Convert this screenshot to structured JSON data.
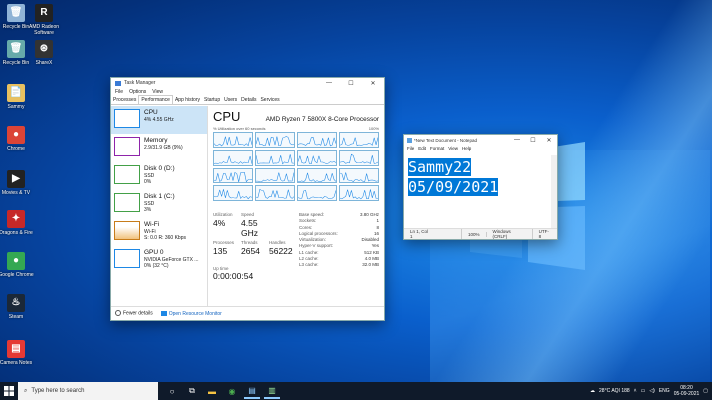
{
  "desktop": {
    "icons": [
      {
        "label": "Recycle Bin",
        "glyph": "🗑",
        "bg": "#8fb3d6"
      },
      {
        "label": "AMD Radeon Software",
        "glyph": "R",
        "bg": "#222"
      },
      {
        "label": "Recycle Bin",
        "glyph": "🗑",
        "bg": "#6aa"
      },
      {
        "label": "ShareX",
        "glyph": "⊛",
        "bg": "#333"
      },
      {
        "label": "Sammy",
        "glyph": "📄",
        "bg": "#e8c060"
      },
      {
        "label": "Chrome",
        "glyph": "●",
        "bg": "#db4437"
      },
      {
        "label": "Movies & TV",
        "glyph": "▶",
        "bg": "#222"
      },
      {
        "label": "Dragons & Fire",
        "glyph": "✦",
        "bg": "#c62828"
      },
      {
        "label": "Google Chrome",
        "glyph": "●",
        "bg": "#34a853"
      },
      {
        "label": "Steam",
        "glyph": "♨",
        "bg": "#1b2838"
      },
      {
        "label": "Camera Notes",
        "glyph": "▤",
        "bg": "#e53935"
      }
    ]
  },
  "task_manager": {
    "title": "Task Manager",
    "menu": [
      "File",
      "Options",
      "View"
    ],
    "tabs": [
      "Processes",
      "Performance",
      "App history",
      "Startup",
      "Users",
      "Details",
      "Services"
    ],
    "resources": [
      {
        "name": "CPU",
        "line1": "4%  4.55 GHz",
        "line2": "",
        "color": "#1e88e5"
      },
      {
        "name": "Memory",
        "line1": "2.9/31.9 GB (9%)",
        "line2": "",
        "color": "#8e24aa"
      },
      {
        "name": "Disk 0 (D:)",
        "line1": "SSD",
        "line2": "0%",
        "color": "#43a047"
      },
      {
        "name": "Disk 1 (C:)",
        "line1": "SSD",
        "line2": "3%",
        "color": "#43a047"
      },
      {
        "name": "Wi-Fi",
        "line1": "Wi-Fi",
        "line2": "S: 0.0  R: 360 Kbps",
        "color": "#c77c1a"
      },
      {
        "name": "GPU 0",
        "line1": "NVIDIA GeForce GTX ...",
        "line2": "0% (32 °C)",
        "color": "#1e88e5"
      }
    ],
    "cpu": {
      "title": "CPU",
      "processor": "AMD Ryzen 7 5800X 8-Core Processor",
      "graph_label": "% Utilization over 60 seconds",
      "graph_max": "100%",
      "stats": [
        {
          "k": "Utilization",
          "v": "4%"
        },
        {
          "k": "Speed",
          "v": "4.55 GHz"
        },
        {
          "k": "",
          "v": ""
        },
        {
          "k": "Processes",
          "v": "135"
        },
        {
          "k": "Threads",
          "v": "2654"
        },
        {
          "k": "Handles",
          "v": "56222"
        }
      ],
      "uptime_label": "Up time",
      "uptime": "0:00:00:54",
      "details": [
        {
          "k": "Base speed:",
          "v": "3.80 GHz"
        },
        {
          "k": "Sockets:",
          "v": "1"
        },
        {
          "k": "Cores:",
          "v": "8"
        },
        {
          "k": "Logical processors:",
          "v": "16"
        },
        {
          "k": "Virtualization:",
          "v": "Disabled"
        },
        {
          "k": "Hyper-V support:",
          "v": "Yes"
        },
        {
          "k": "L1 cache:",
          "v": "512 KB"
        },
        {
          "k": "L2 cache:",
          "v": "4.0 MB"
        },
        {
          "k": "L3 cache:",
          "v": "32.0 MB"
        }
      ]
    },
    "footer": {
      "fewer": "Fewer details",
      "monitor": "Open Resource Monitor"
    }
  },
  "notepad": {
    "title": "*New Text Document - Notepad",
    "menu": [
      "File",
      "Edit",
      "Format",
      "View",
      "Help"
    ],
    "line1": "Sammy22",
    "line2": "05/09/2021",
    "status": [
      "Ln 1, Col 1",
      "100%",
      "Windows (CRLF)",
      "UTF-8"
    ]
  },
  "taskbar": {
    "search_placeholder": "Type here to search",
    "weather": "28°C  AQI 188",
    "lang": "ENG",
    "time": "08:20",
    "date": "05-09-2021"
  }
}
